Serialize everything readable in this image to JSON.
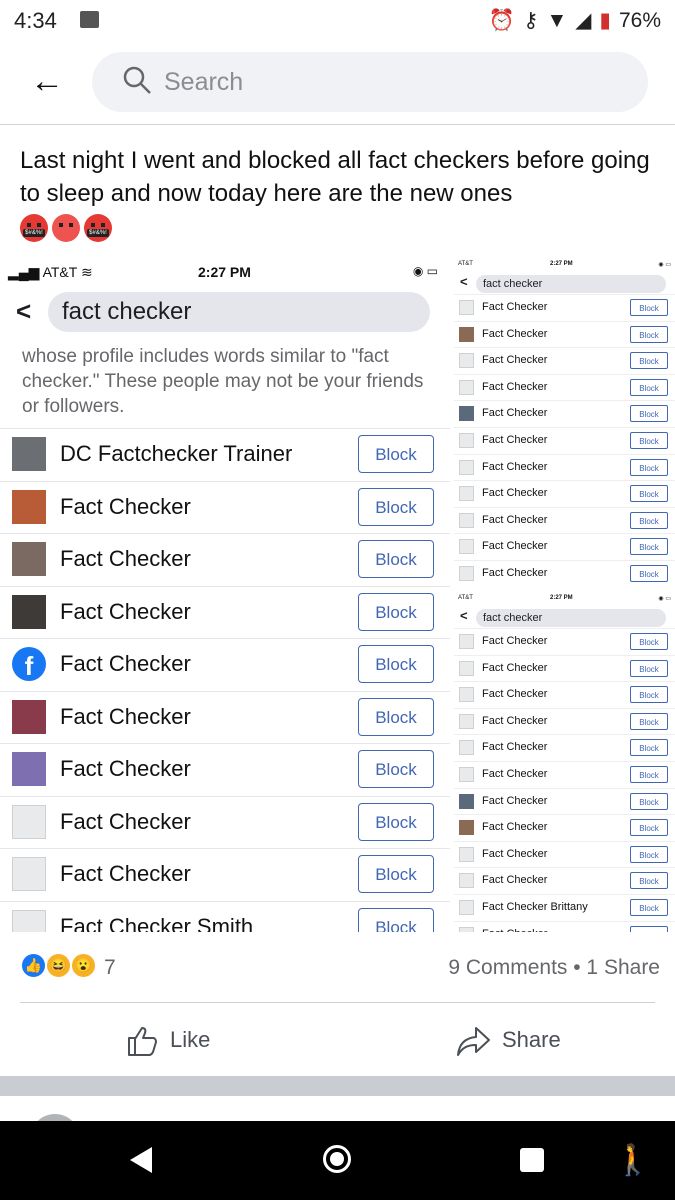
{
  "status_bar": {
    "time": "4:34",
    "battery": "76%"
  },
  "top_bar": {
    "search_placeholder": "Search"
  },
  "post": {
    "text": "Last night I went and blocked all fact checkers before going to sleep and now today here are the new ones",
    "emoji_label": "$#&%!"
  },
  "main_screenshot": {
    "carrier": "AT&T",
    "time": "2:27 PM",
    "search_query": "fact checker",
    "description": "whose profile includes words similar to \"fact checker.\" These people may not be your friends or followers.",
    "block_label": "Block",
    "rows": [
      {
        "name": "DC Factchecker Trainer"
      },
      {
        "name": "Fact Checker"
      },
      {
        "name": "Fact Checker"
      },
      {
        "name": "Fact Checker"
      },
      {
        "name": "Fact Checker"
      },
      {
        "name": "Fact Checker"
      },
      {
        "name": "Fact Checker"
      },
      {
        "name": "Fact Checker"
      },
      {
        "name": "Fact Checker"
      },
      {
        "name": "Fact Checker Smith"
      }
    ]
  },
  "small_screenshot_top": {
    "carrier": "AT&T",
    "time": "2:27 PM",
    "search_query": "fact checker",
    "block_label": "Block",
    "rows": [
      "Fact Checker",
      "Fact Checker",
      "Fact Checker",
      "Fact Checker",
      "Fact Checker",
      "Fact Checker",
      "Fact Checker",
      "Fact Checker",
      "Fact Checker",
      "Fact Checker",
      "Fact Checker"
    ]
  },
  "small_screenshot_bottom": {
    "carrier": "AT&T",
    "time": "2:27 PM",
    "search_query": "fact checker",
    "block_label": "Block",
    "rows": [
      "Fact Checker",
      "Fact Checker",
      "Fact Checker",
      "Fact Checker",
      "Fact Checker",
      "Fact Checker",
      "Fact Checker",
      "Fact Checker",
      "Fact Checker",
      "Fact Checker",
      "Fact Checker Brittany",
      "Fact Checker"
    ]
  },
  "engagement": {
    "reaction_count": "7",
    "comments_shares": "9 Comments • 1 Share"
  },
  "actions": {
    "like_label": "Like",
    "share_label": "Share"
  },
  "colors": {
    "fb_blue": "#1877f2",
    "block_blue": "#4267b2",
    "reaction_yellow": "#f7b125"
  }
}
